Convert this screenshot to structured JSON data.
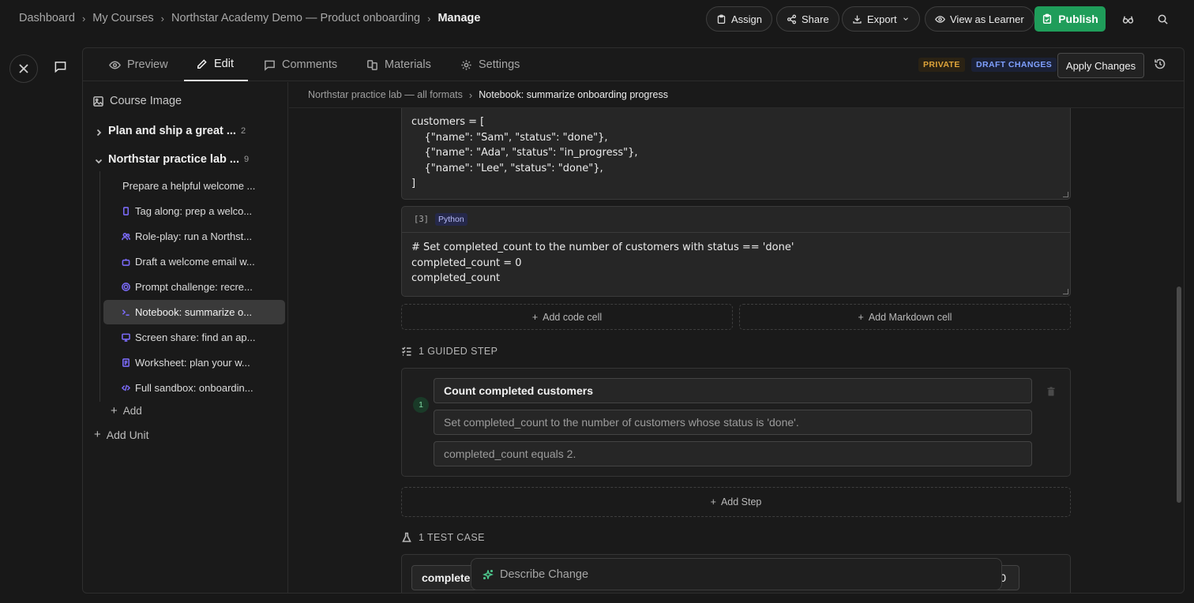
{
  "breadcrumb": [
    "Dashboard",
    "My Courses",
    "Northstar Academy Demo — Product onboarding",
    "Manage"
  ],
  "topbar": {
    "assign": "Assign",
    "share": "Share",
    "export": "Export",
    "view_as_learner": "View as Learner",
    "publish": "Publish"
  },
  "tabs": [
    "Preview",
    "Edit",
    "Comments",
    "Materials",
    "Settings"
  ],
  "active_tab": "Edit",
  "status": {
    "private": "PRIVATE",
    "draft": "DRAFT CHANGES"
  },
  "apply_changes": "Apply Changes",
  "sidebar": {
    "course_image": "Course Image",
    "units": [
      {
        "title": "Plan and ship a great ...",
        "count": "2",
        "expanded": false
      },
      {
        "title": "Northstar practice lab ...",
        "count": "9",
        "expanded": true
      }
    ],
    "lessons": [
      {
        "label": "Prepare a helpful welcome ...",
        "icon": "none"
      },
      {
        "label": "Tag along: prep a welco...",
        "icon": "phone-icon"
      },
      {
        "label": "Role-play: run a Northst...",
        "icon": "people-icon"
      },
      {
        "label": "Draft a welcome email w...",
        "icon": "bot-icon"
      },
      {
        "label": "Prompt challenge: recre...",
        "icon": "target-icon"
      },
      {
        "label": "Notebook: summarize o...",
        "icon": "terminal-icon",
        "selected": true
      },
      {
        "label": "Screen share: find an ap...",
        "icon": "monitor-icon"
      },
      {
        "label": "Worksheet: plan your w...",
        "icon": "worksheet-icon"
      },
      {
        "label": "Full sandbox: onboardin...",
        "icon": "code-icon"
      }
    ],
    "add": "Add",
    "add_unit": "Add Unit"
  },
  "content_breadcrumb": [
    "Northstar practice lab — all formats",
    "Notebook: summarize onboarding progress"
  ],
  "cells": [
    {
      "code": "customers = [\n    {\"name\": \"Sam\", \"status\": \"done\"},\n    {\"name\": \"Ada\", \"status\": \"in_progress\"},\n    {\"name\": \"Lee\", \"status\": \"done\"},\n]"
    },
    {
      "number": "[3]",
      "language": "Python",
      "code": "# Set completed_count to the number of customers with status == 'done'\ncompleted_count = 0\ncompleted_count"
    }
  ],
  "add_code_cell": "Add code cell",
  "add_markdown_cell": "Add Markdown cell",
  "guided_steps_label": "1 GUIDED STEP",
  "step": {
    "number": "1",
    "title": "Count completed customers",
    "instruction": "Set completed_count to the number of customers whose status is 'done'.",
    "check": "completed_count equals 2."
  },
  "add_step": "Add Step",
  "test_cases_label": "1 TEST CASE",
  "test_case": {
    "name": "complete",
    "value": "0"
  },
  "describe_change": "Describe Change"
}
